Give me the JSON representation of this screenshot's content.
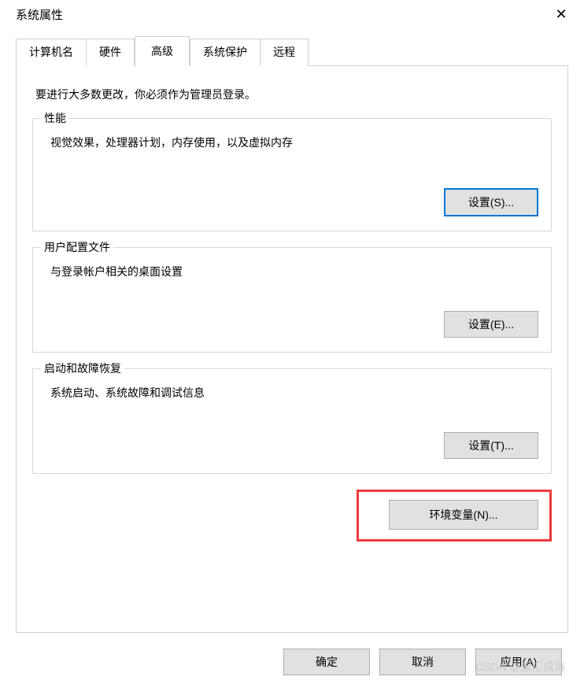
{
  "title": "系统属性",
  "tabs": {
    "computer_name": "计算机名",
    "hardware": "硬件",
    "advanced": "高级",
    "system_protection": "系统保护",
    "remote": "远程"
  },
  "admin_note": "要进行大多数更改，你必须作为管理员登录。",
  "groups": {
    "performance": {
      "title": "性能",
      "desc": "视觉效果，处理器计划，内存使用，以及虚拟内存",
      "button": "设置(S)..."
    },
    "user_profile": {
      "title": "用户配置文件",
      "desc": "与登录帐户相关的桌面设置",
      "button": "设置(E)..."
    },
    "startup_recovery": {
      "title": "启动和故障恢复",
      "desc": "系统启动、系统故障和调试信息",
      "button": "设置(T)..."
    }
  },
  "env_var_button": "环境变量(N)...",
  "footer": {
    "ok": "确定",
    "cancel": "取消",
    "apply": "应用(A)"
  },
  "watermark": "CSDN @聚汇成海"
}
